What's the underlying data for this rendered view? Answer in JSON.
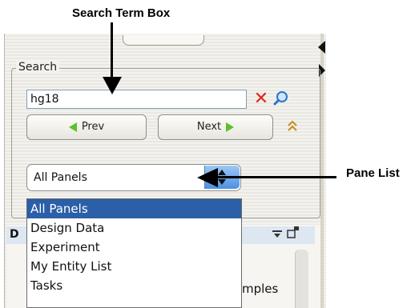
{
  "callouts": {
    "search_term_box": "Search Term Box",
    "pane_list": "Pane List"
  },
  "search_group": {
    "label": "Search",
    "input_value": "hg18",
    "clear_icon": "close-icon",
    "go_icon": "search-icon",
    "prev_label": "Prev",
    "next_label": "Next",
    "collapse_icon": "chevron-double-up-icon"
  },
  "pane_combo": {
    "selected": "All Panels",
    "arrow_icon": "updown-spinner-icon",
    "options": [
      "All Panels",
      "Design Data",
      "Experiment",
      "My Entity List",
      "Tasks"
    ]
  },
  "lower_panel": {
    "header_initial": "D",
    "partial_text": "mples"
  },
  "colors": {
    "accent_blue": "#2b5fa8",
    "clear_red": "#e0261b",
    "arrow_green": "#5fbf2b"
  }
}
